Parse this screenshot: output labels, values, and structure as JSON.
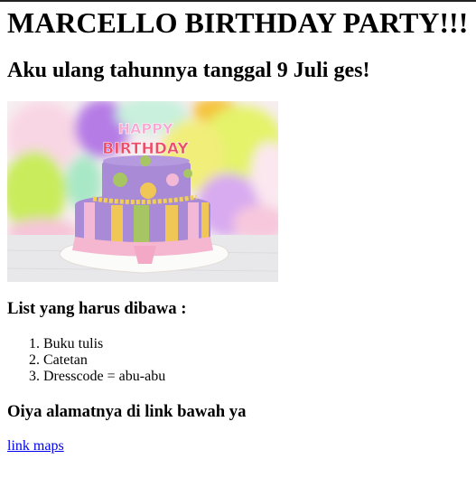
{
  "title": "MARCELLO BIRTHDAY PARTY!!!",
  "subtitle": "Aku ulang tahunnya tanggal 9 Juli ges!",
  "image": {
    "description_icon": "birthday-cake-image",
    "candle_text": "HAPPY BIRTHDAY"
  },
  "list_heading": "List yang harus dibawa :",
  "items": [
    "Buku tulis",
    "Catetan",
    "Dresscode = abu-abu"
  ],
  "address_heading": "Oiya alamatnya di link bawah ya",
  "link_label": "link maps",
  "colors": {
    "link": "#0000ee"
  }
}
